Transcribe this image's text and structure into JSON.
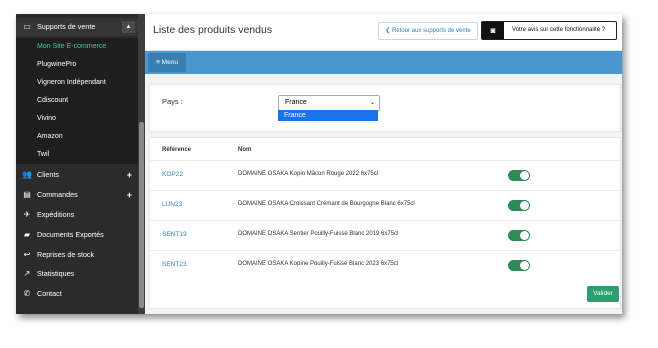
{
  "sidebar": {
    "parent": {
      "label": "Supports de vente",
      "icon": "devices-icon"
    },
    "sub_items": [
      {
        "label": "Mon Site E-commerce",
        "active": true
      },
      {
        "label": "PlugwinePro"
      },
      {
        "label": "Vigneron Indépendant"
      },
      {
        "label": "Cdiscount"
      },
      {
        "label": "Vivino"
      },
      {
        "label": "Amazon"
      },
      {
        "label": "Twil"
      }
    ],
    "items": [
      {
        "label": "Clients",
        "icon": "users-icon",
        "has_plus": true
      },
      {
        "label": "Commandes",
        "icon": "clipboard-icon",
        "has_plus": true
      },
      {
        "label": "Expéditions",
        "icon": "plane-icon"
      },
      {
        "label": "Documents Exportés",
        "icon": "truck-icon"
      },
      {
        "label": "Reprises de stock",
        "icon": "return-icon"
      },
      {
        "label": "Statistiques",
        "icon": "chart-icon"
      },
      {
        "label": "Contact",
        "icon": "phone-icon"
      }
    ],
    "plus_symbol": "+"
  },
  "header": {
    "title": "Liste des produits vendus",
    "back_button": "Retour aux supports de vente",
    "feedback_button": "Votre avis sur cette fonctionnalité ?"
  },
  "menubar": {
    "menu_label": "Menu"
  },
  "filter": {
    "label": "Pays :",
    "selected": "France",
    "options": [
      "France"
    ]
  },
  "table": {
    "headers": [
      "Référence",
      "Nom"
    ],
    "rows": [
      {
        "ref": "KOP22",
        "nom": "DOMAINE OSAKA Kopin Mâcon Rouge 2022 6x75cl",
        "enabled": true
      },
      {
        "ref": "LUN23",
        "nom": "DOMAINE OSAKA Croissant Crémant de Bourgogne Blanc 6x75cl",
        "enabled": true
      },
      {
        "ref": "SENT19",
        "nom": "DOMAINE OSAKA Sentier Pouilly-Fuissé Blanc 2019 6x75cl",
        "enabled": true
      },
      {
        "ref": "SENT23",
        "nom": "DOMAINE OSAKA Kopine Pouilly-Fuissé Blanc 2023 6x75cl",
        "enabled": true
      }
    ]
  },
  "submit": {
    "label": "Valider"
  },
  "colors": {
    "accent_blue": "#4a97cf",
    "toggle_green": "#2e8b57",
    "active_green": "#3ecf8e"
  }
}
